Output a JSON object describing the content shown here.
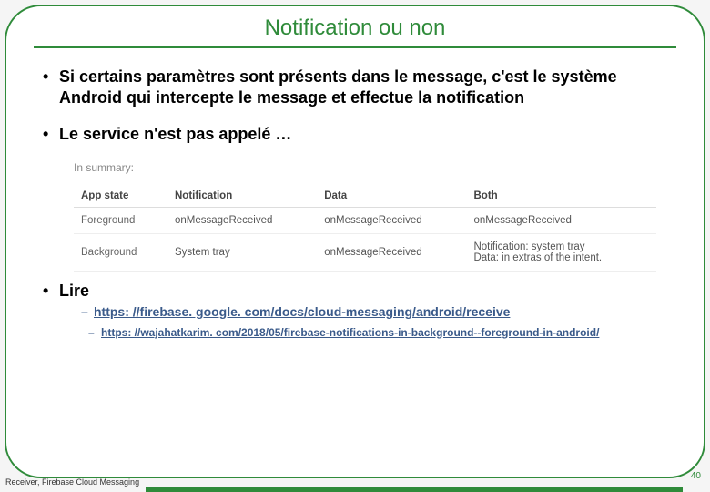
{
  "title": "Notification ou non",
  "bullets": {
    "b1": "Si certains paramètres sont présents dans le message, c'est le système Android qui intercepte le message et effectue la notification",
    "b2": "Le service n'est pas appelé …",
    "b3": "Lire"
  },
  "table": {
    "caption": "In summary:",
    "headers": {
      "c1": "App state",
      "c2": "Notification",
      "c3": "Data",
      "c4": "Both"
    },
    "rows": [
      {
        "c1": "Foreground",
        "c2": "onMessageReceived",
        "c3": "onMessageReceived",
        "c4": "onMessageReceived"
      },
      {
        "c1": "Background",
        "c2": "System tray",
        "c3": "onMessageReceived",
        "c4": "Notification: system tray\nData: in extras of the intent."
      }
    ]
  },
  "links": {
    "l1": "https: //firebase. google. com/docs/cloud-messaging/android/receive",
    "l2": "https: //wajahatkarim. com/2018/05/firebase-notifications-in-background--foreground-in-android/"
  },
  "footer": "Receiver, Firebase Cloud Messaging",
  "page": "40"
}
